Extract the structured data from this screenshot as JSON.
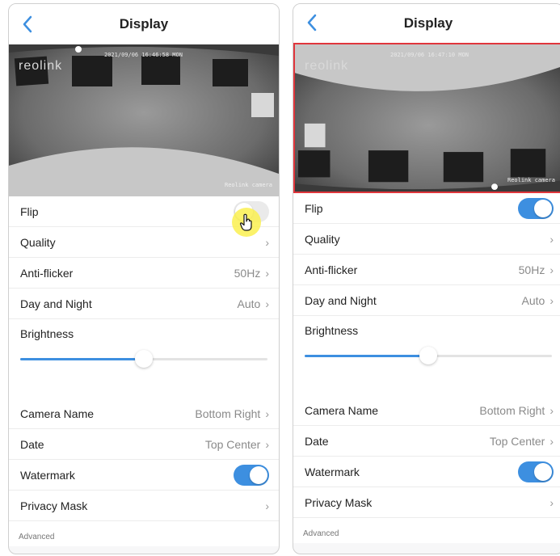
{
  "left": {
    "title": "Display",
    "preview": {
      "logo": "reolink",
      "timestamp": "2021/09/06 16:46:58 MON",
      "camera_label": "Reolink camera"
    },
    "flip": {
      "label": "Flip",
      "state": "off"
    },
    "quality": {
      "label": "Quality"
    },
    "antiflicker": {
      "label": "Anti-flicker",
      "value": "50Hz"
    },
    "daynight": {
      "label": "Day and Night",
      "value": "Auto"
    },
    "brightness": {
      "label": "Brightness",
      "level_percent": 50
    },
    "camera_name": {
      "label": "Camera Name",
      "value": "Bottom Right"
    },
    "date": {
      "label": "Date",
      "value": "Top Center"
    },
    "watermark": {
      "label": "Watermark",
      "state": "on"
    },
    "privacy_mask": {
      "label": "Privacy Mask"
    },
    "advanced": "Advanced"
  },
  "right": {
    "title": "Display",
    "preview": {
      "logo": "reolink",
      "timestamp": "2021/09/06 16:47:10 MON",
      "camera_label": "Reolink camera"
    },
    "flip": {
      "label": "Flip",
      "state": "on"
    },
    "quality": {
      "label": "Quality"
    },
    "antiflicker": {
      "label": "Anti-flicker",
      "value": "50Hz"
    },
    "daynight": {
      "label": "Day and Night",
      "value": "Auto"
    },
    "brightness": {
      "label": "Brightness",
      "level_percent": 50
    },
    "camera_name": {
      "label": "Camera Name",
      "value": "Bottom Right"
    },
    "date": {
      "label": "Date",
      "value": "Top Center"
    },
    "watermark": {
      "label": "Watermark",
      "state": "on"
    },
    "privacy_mask": {
      "label": "Privacy Mask"
    },
    "advanced": "Advanced"
  },
  "colors": {
    "accent": "#3d8fe0",
    "highlight_border": "#e0363c",
    "cursor_highlight": "#f7ee55"
  },
  "icons": {
    "back": "chevron-left-icon",
    "chevron": "chevron-right-icon",
    "cursor": "hand-pointer-icon"
  }
}
